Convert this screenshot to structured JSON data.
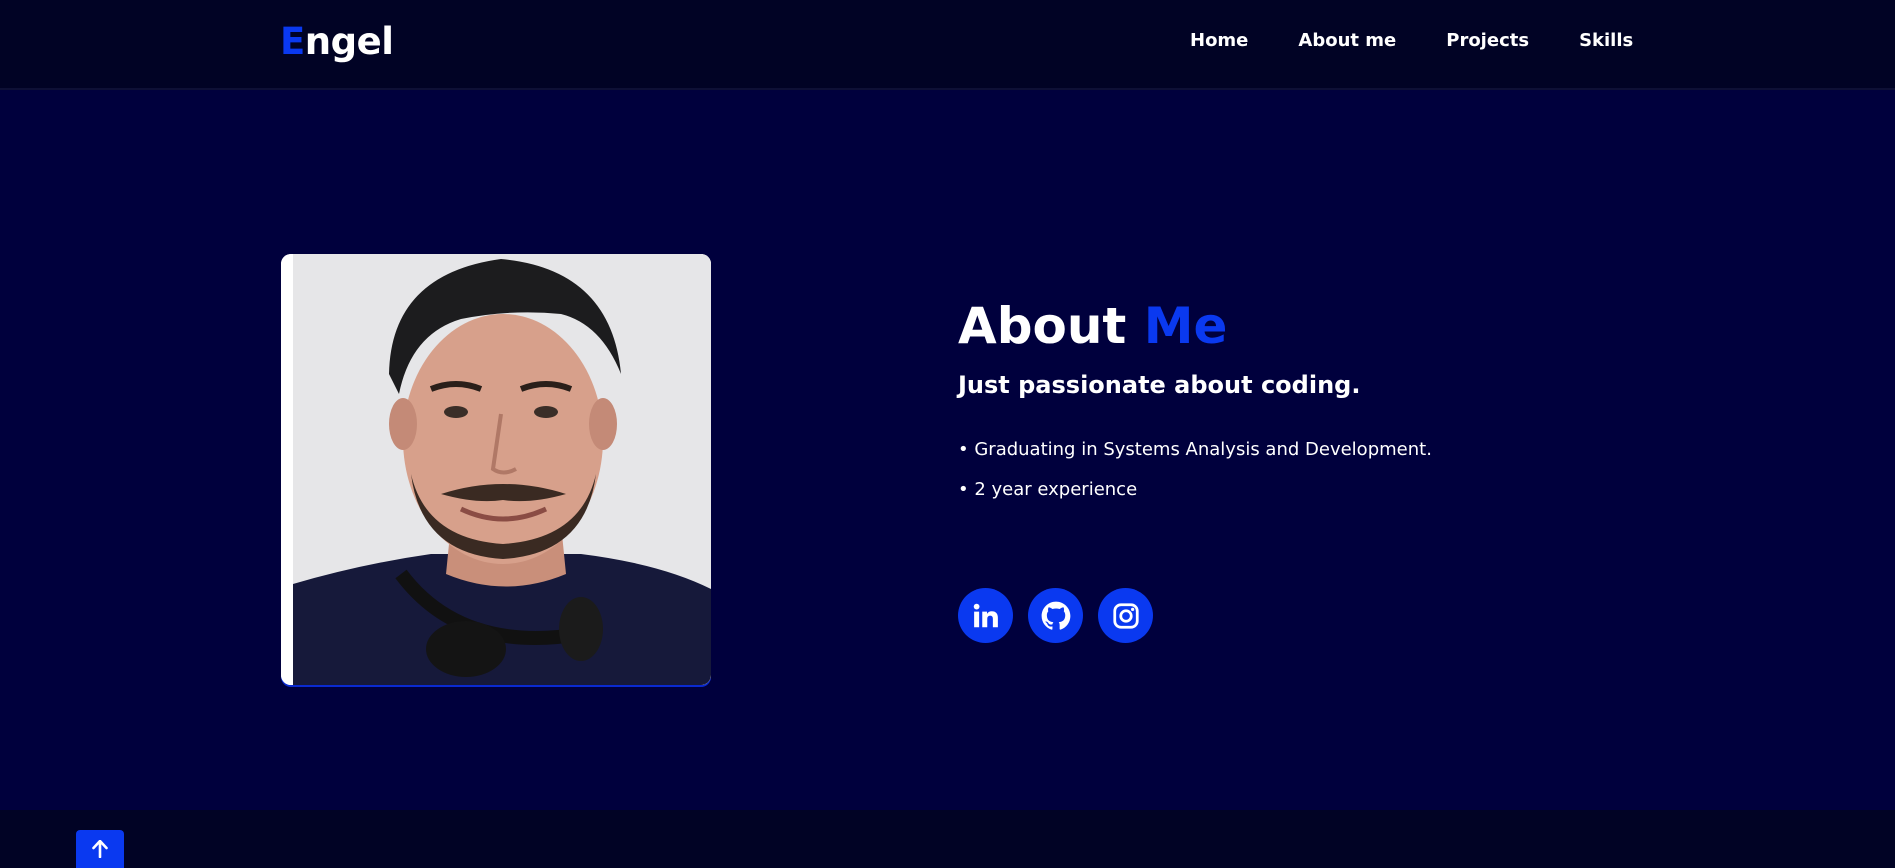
{
  "nav": {
    "logo_first": "E",
    "logo_rest": "ngel",
    "links": [
      "Home",
      "About me",
      "Projects",
      "Skills"
    ]
  },
  "about": {
    "title_main": "About",
    "title_accent": "Me",
    "subtitle": "Just passionate about coding.",
    "bullets": [
      "• Graduating in Systems Analysis and Development.",
      "• 2 year experience"
    ]
  },
  "socials": [
    "linkedin-icon",
    "github-icon",
    "instagram-icon"
  ],
  "scroll_top_icon": "arrow-up-icon",
  "colors": {
    "nav_bg": "#010325",
    "page_bg": "#00003d",
    "accent": "#0a39f0",
    "text": "#ffffff"
  }
}
